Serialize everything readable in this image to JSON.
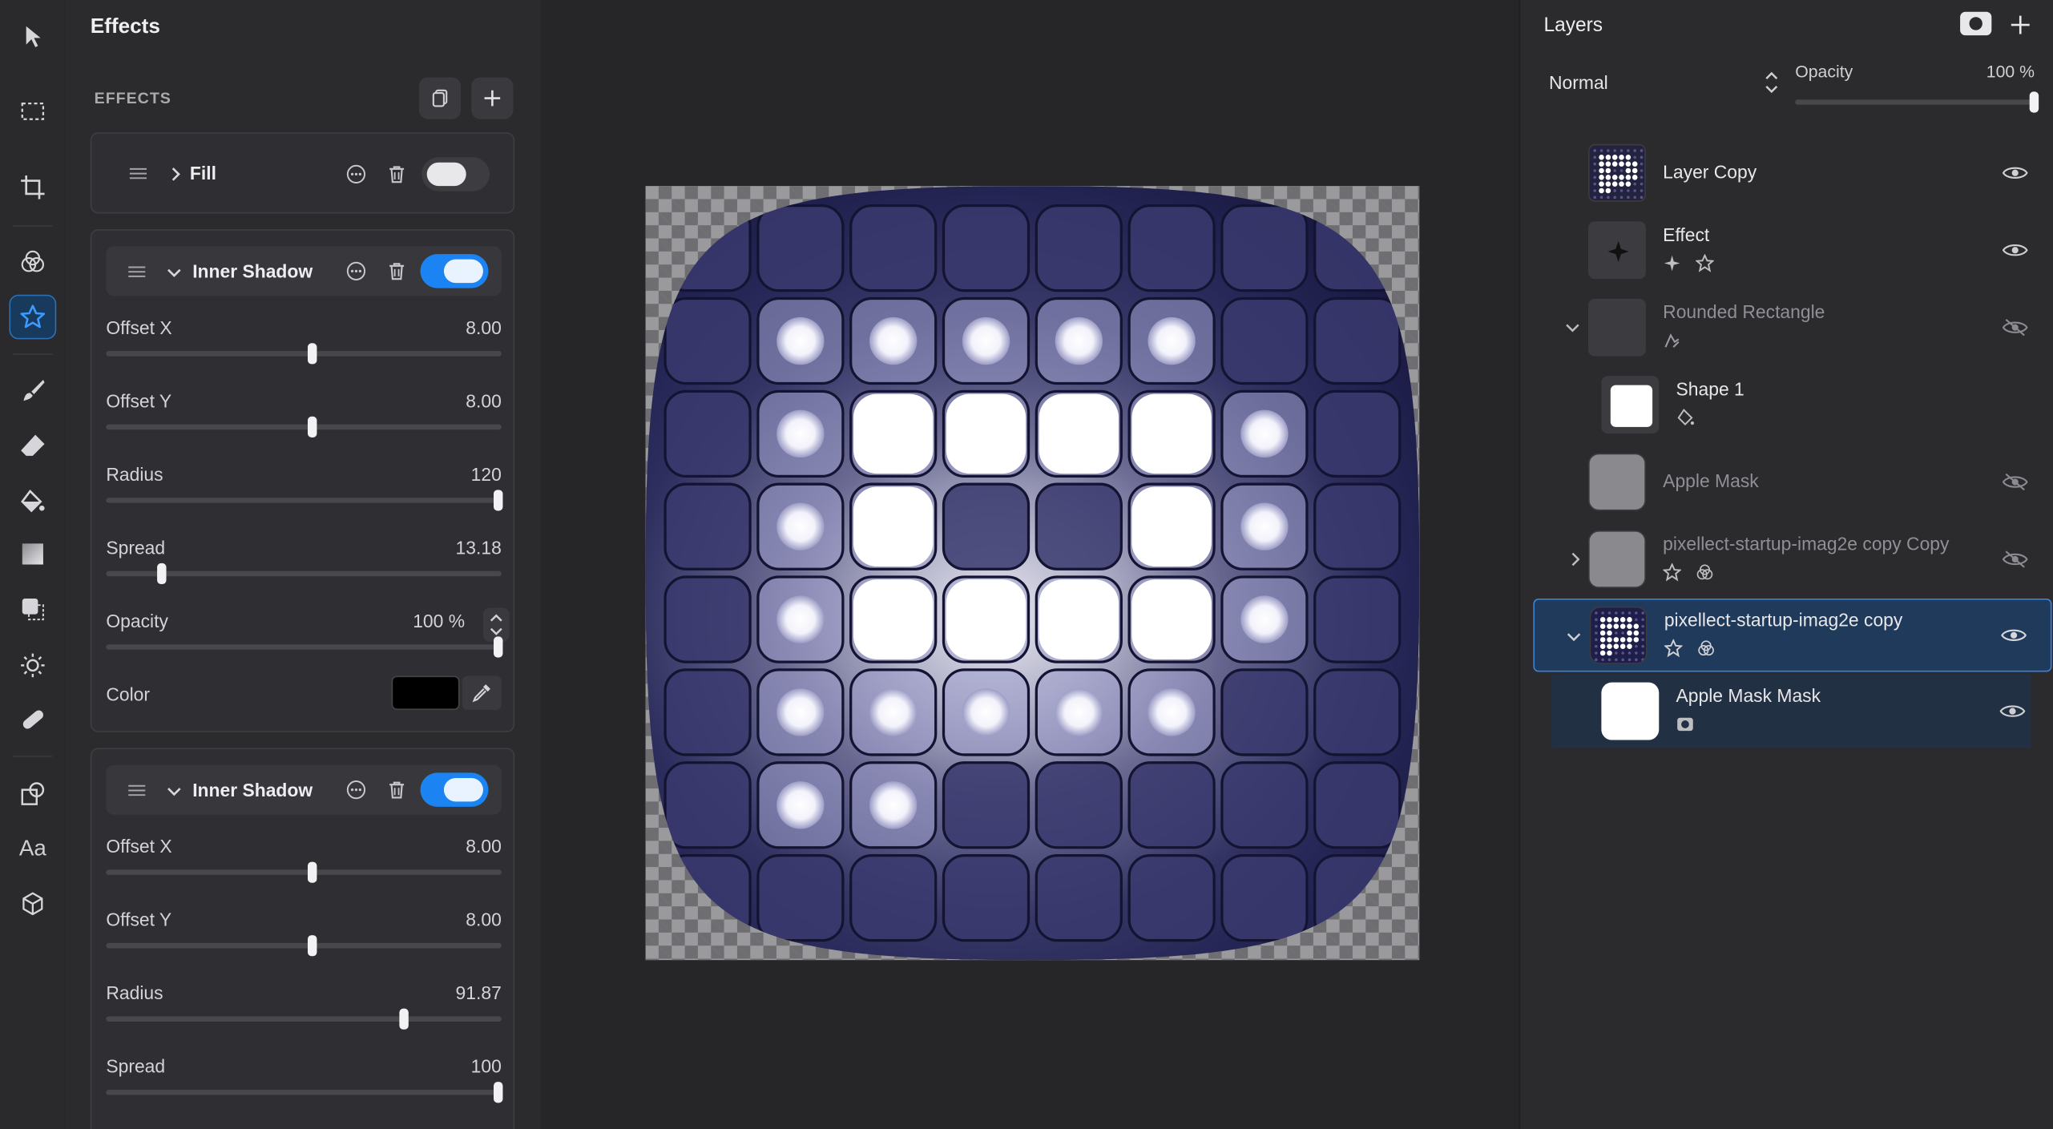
{
  "toolbar": {
    "tools": [
      "select-arrow",
      "marquee",
      "crop",
      "adjust-circles",
      "effects-star",
      "brush",
      "eraser",
      "fill-bucket",
      "gradient",
      "shape-select",
      "brightness",
      "bandage",
      "shapes",
      "text",
      "cube"
    ],
    "text_tool_label": "Aa",
    "active": "effects-star"
  },
  "effects_panel": {
    "title": "Effects",
    "section_label": "EFFECTS",
    "fill": {
      "name": "Fill",
      "enabled": false
    },
    "inner_shadow_1": {
      "name": "Inner Shadow",
      "enabled": true,
      "offset_x": {
        "label": "Offset X",
        "value": "8.00",
        "fraction": 0.52
      },
      "offset_y": {
        "label": "Offset Y",
        "value": "8.00",
        "fraction": 0.52
      },
      "radius": {
        "label": "Radius",
        "value": "120",
        "fraction": 0.99
      },
      "spread": {
        "label": "Spread",
        "value": "13.18",
        "fraction": 0.14
      },
      "opacity": {
        "label": "Opacity",
        "value": "100 %",
        "fraction": 0.99
      },
      "color": {
        "label": "Color",
        "value": "#000000"
      }
    },
    "inner_shadow_2": {
      "name": "Inner Shadow",
      "enabled": true,
      "offset_x": {
        "label": "Offset X",
        "value": "8.00",
        "fraction": 0.52
      },
      "offset_y": {
        "label": "Offset Y",
        "value": "8.00",
        "fraction": 0.52
      },
      "radius": {
        "label": "Radius",
        "value": "91.87",
        "fraction": 0.75
      },
      "spread": {
        "label": "Spread",
        "value": "100",
        "fraction": 0.99
      }
    }
  },
  "canvas": {
    "description_colors": {
      "base": "#2a2a5a",
      "glow": "#ffffff"
    },
    "grid_size": 8,
    "lit_cells": [
      [
        1,
        1
      ],
      [
        1,
        2
      ],
      [
        1,
        3
      ],
      [
        1,
        4
      ],
      [
        1,
        5
      ],
      [
        2,
        1
      ],
      [
        2,
        2
      ],
      [
        2,
        3
      ],
      [
        2,
        4
      ],
      [
        2,
        5
      ],
      [
        2,
        6
      ],
      [
        3,
        1
      ],
      [
        3,
        2
      ],
      [
        3,
        5
      ],
      [
        3,
        6
      ],
      [
        4,
        1
      ],
      [
        4,
        2
      ],
      [
        4,
        3
      ],
      [
        4,
        4
      ],
      [
        4,
        5
      ],
      [
        4,
        6
      ],
      [
        5,
        1
      ],
      [
        5,
        2
      ],
      [
        5,
        3
      ],
      [
        5,
        4
      ],
      [
        5,
        5
      ],
      [
        6,
        1
      ],
      [
        6,
        2
      ]
    ],
    "big_cells": [
      [
        2,
        2
      ],
      [
        2,
        3
      ],
      [
        2,
        4
      ],
      [
        2,
        5
      ],
      [
        3,
        2
      ],
      [
        3,
        5
      ],
      [
        4,
        2
      ],
      [
        4,
        3
      ],
      [
        4,
        4
      ],
      [
        4,
        5
      ]
    ]
  },
  "layers_panel": {
    "title": "Layers",
    "blend_mode": "Normal",
    "opacity_label": "Opacity",
    "opacity_value": "100 %",
    "opacity_fraction": 1.0,
    "layers": [
      {
        "name": "Layer Copy",
        "dim": false
      },
      {
        "name": "Effect",
        "dim": false
      },
      {
        "name": "Rounded Rectangle",
        "dim": true
      },
      {
        "name": "Shape 1",
        "dim": false
      },
      {
        "name": "Apple Mask",
        "dim": true
      },
      {
        "name": "pixellect-startup-imag2e copy Copy",
        "dim": true
      },
      {
        "name": "pixellect-startup-imag2e copy",
        "dim": false,
        "selected": true
      },
      {
        "name": "Apple Mask Mask",
        "dim": false
      }
    ]
  }
}
